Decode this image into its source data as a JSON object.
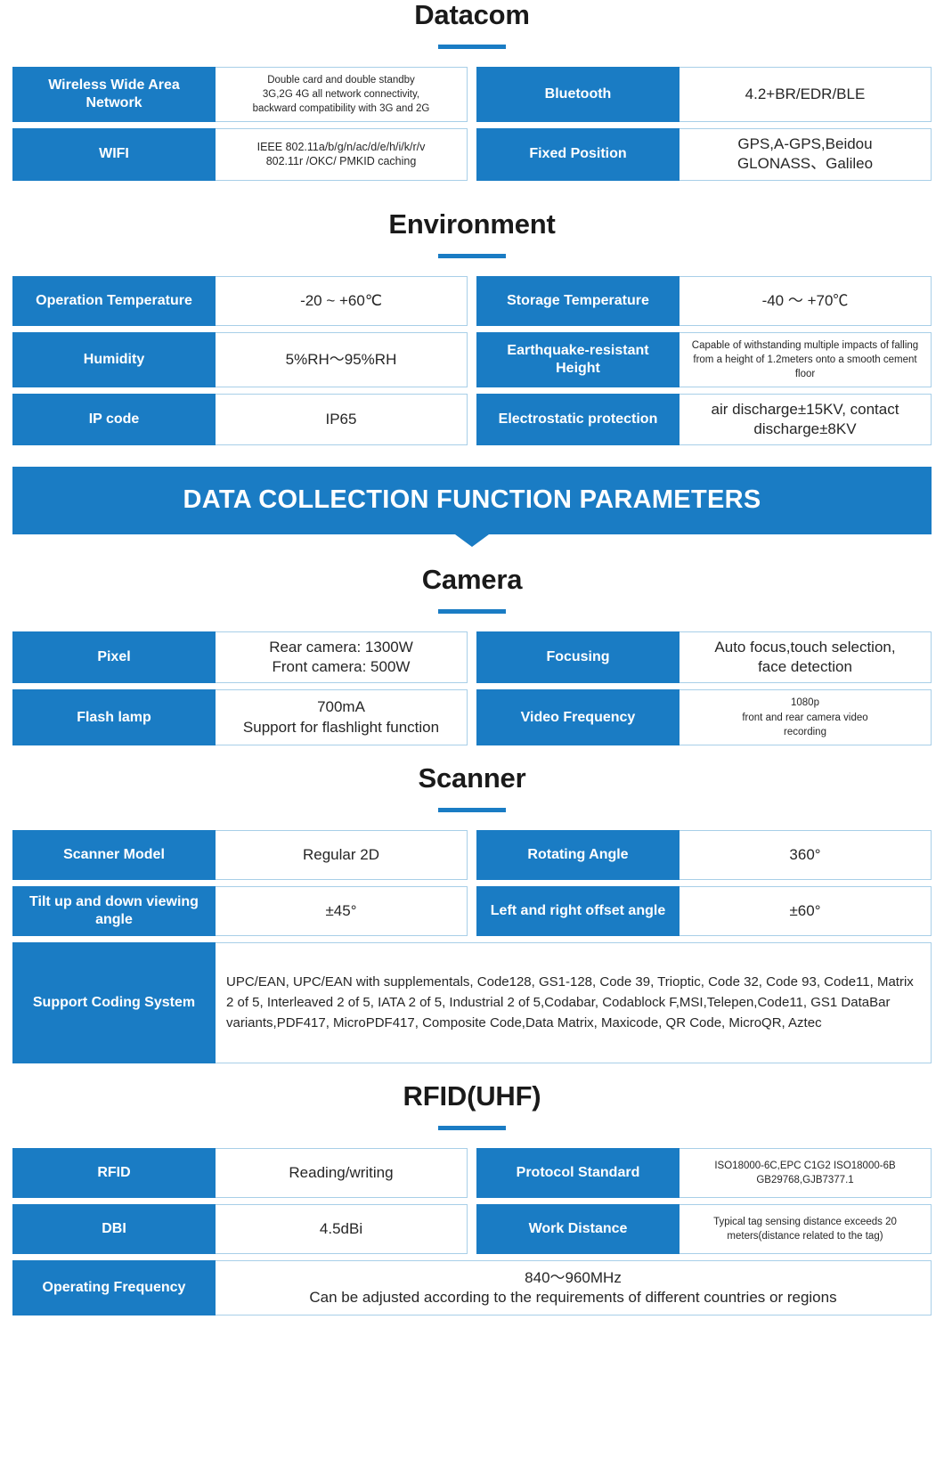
{
  "accent_color": "#1a7cc4",
  "border_color": "#a8cfe8",
  "sections": {
    "datacom": {
      "title": "Datacom",
      "rows": [
        {
          "key": "Wireless Wide Area Network",
          "value": "Double card and double standby\n3G,2G  4G all network connectivity,\nbackward compatibility with 3G and 2G"
        },
        {
          "key": "Bluetooth",
          "value": "4.2+BR/EDR/BLE"
        },
        {
          "key": "WIFI",
          "value": "IEEE 802.11a/b/g/n/ac/d/e/h/i/k/r/v\n802.11r /OKC/ PMKID caching"
        },
        {
          "key": "Fixed Position",
          "value": "GPS,A-GPS,Beidou\nGLONASS、Galileo"
        }
      ]
    },
    "environment": {
      "title": "Environment",
      "rows": [
        {
          "key": "Operation Temperature",
          "value": "-20 ~ +60℃"
        },
        {
          "key": "Storage Temperature",
          "value": "-40 ～ +70℃"
        },
        {
          "key": "Humidity",
          "value": "5%RH～95%RH"
        },
        {
          "key": "Earthquake-resistant Height",
          "value": "Capable of withstanding multiple impacts of falling from a height of 1.2meters onto a smooth cement floor"
        },
        {
          "key": "IP code",
          "value": "IP65"
        },
        {
          "key": "Electrostatic protection",
          "value": "air discharge±15KV, contact\ndischarge±8KV"
        }
      ]
    },
    "banner": {
      "label": "DATA COLLECTION FUNCTION PARAMETERS"
    },
    "camera": {
      "title": "Camera",
      "rows": [
        {
          "key": "Pixel",
          "value": "Rear camera: 1300W\nFront camera: 500W"
        },
        {
          "key": "Focusing",
          "value": "Auto focus,touch selection,\nface detection"
        },
        {
          "key": "Flash lamp",
          "value": "700mA\nSupport for flashlight function"
        },
        {
          "key": "Video Frequency",
          "value": "1080p\nfront and rear camera video\nrecording"
        }
      ]
    },
    "scanner": {
      "title": "Scanner",
      "rows": [
        {
          "key": "Scanner Model",
          "value": "Regular 2D"
        },
        {
          "key": "Rotating Angle",
          "value": "360°"
        },
        {
          "key": "Tilt up and down viewing angle",
          "value": "±45°"
        },
        {
          "key": "Left and right offset angle",
          "value": "±60°"
        },
        {
          "key": "Support Coding System",
          "value": "UPC/EAN, UPC/EAN with supplementals, Code128, GS1-128, Code 39, Trioptic, Code 32, Code 93, Code11, Matrix 2 of 5, Interleaved 2 of 5, IATA 2 of 5, Industrial 2 of 5,Codabar, Codablock F,MSI,Telepen,Code11, GS1 DataBar variants,PDF417, MicroPDF417, Composite Code,Data Matrix, Maxicode, QR Code, MicroQR, Aztec"
        }
      ]
    },
    "rfid": {
      "title": "RFID(UHF)",
      "rows": [
        {
          "key": "RFID",
          "value": "Reading/writing"
        },
        {
          "key": "Protocol Standard",
          "value": "ISO18000-6C,EPC C1G2 ISO18000-6B\nGB29768,GJB7377.1"
        },
        {
          "key": "DBI",
          "value": "4.5dBi"
        },
        {
          "key": "Work Distance",
          "value": "Typical tag sensing distance exceeds 20\nmeters(distance related to the tag)"
        },
        {
          "key": "Operating Frequency",
          "value": "840～960MHz\nCan be adjusted according to the requirements of different countries or regions"
        }
      ]
    }
  }
}
